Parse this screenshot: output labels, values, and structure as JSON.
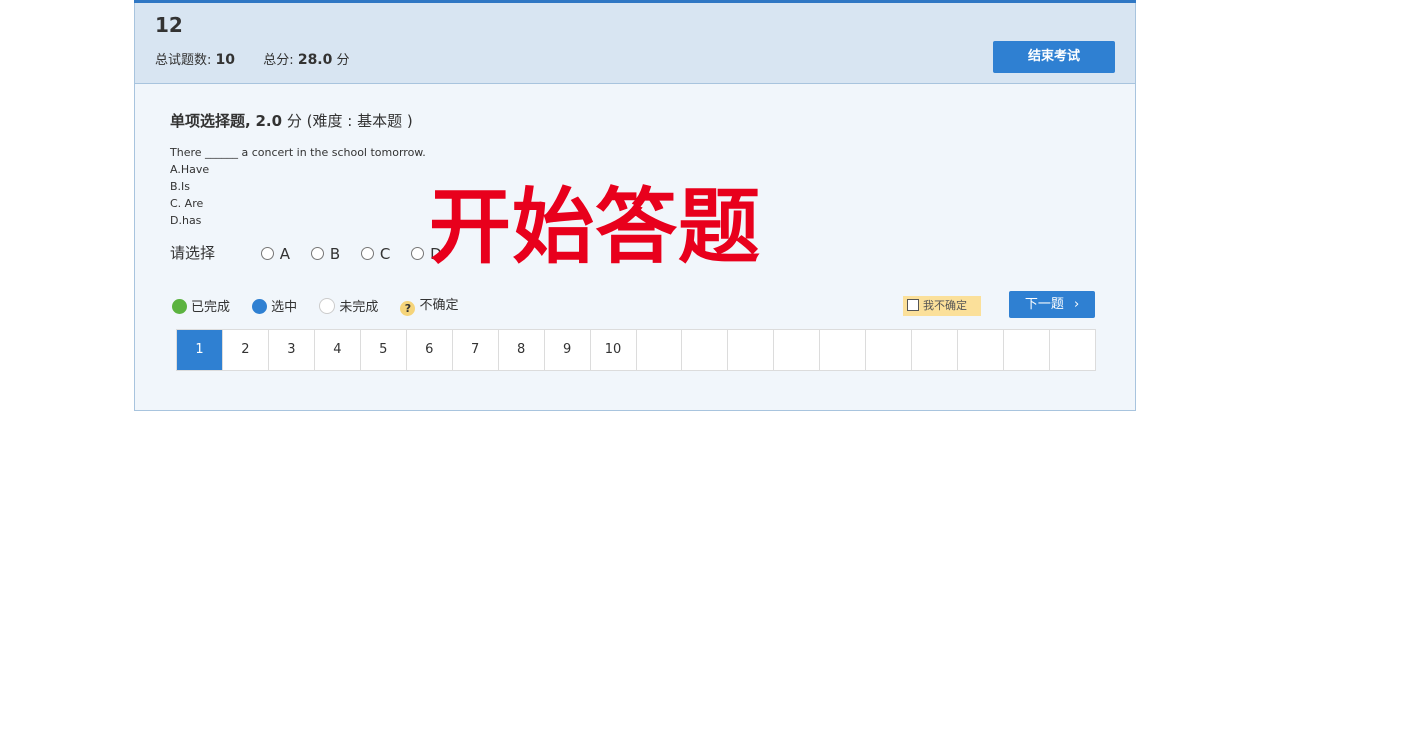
{
  "header": {
    "title": "12",
    "total_label": "总试题数:",
    "total_value": "10",
    "score_label": "总分:",
    "score_value": "28.0",
    "score_unit": "分",
    "end_button": "结束考试"
  },
  "question": {
    "type_label": "单项选择题,",
    "points": "2.0",
    "points_unit": "分",
    "difficulty": "(难度 : 基本题 )",
    "stem": "There ______ a concert in the school tomorrow.",
    "option_lines": [
      "A.Have",
      "B.Is",
      "C. Are",
      "D.has"
    ],
    "choose_label": "请选择",
    "choices": [
      "A",
      "B",
      "C",
      "D"
    ]
  },
  "overlay_text": "开始答题",
  "legend": {
    "done": "已完成",
    "selected": "选中",
    "undone": "未完成",
    "unsure_icon": "?",
    "unsure": "不确定"
  },
  "unsure_checkbox_label": "我不确定",
  "next_button": "下一题",
  "next_icon_glyph": "›",
  "grid": {
    "cells": [
      "1",
      "2",
      "3",
      "4",
      "5",
      "6",
      "7",
      "8",
      "9",
      "10",
      "",
      "",
      "",
      "",
      "",
      "",
      "",
      "",
      "",
      ""
    ],
    "active_index": 0
  },
  "colors": {
    "accent": "#2f80d2",
    "done": "#5cb340",
    "overlay": "#e8001c",
    "unsure_bg": "#fbe09a"
  }
}
